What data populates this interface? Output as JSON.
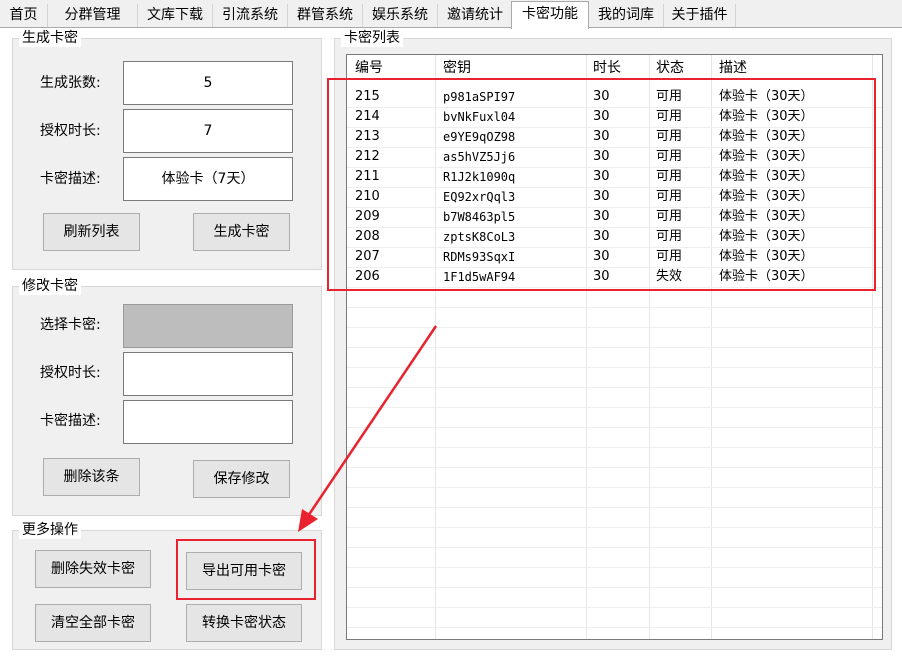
{
  "tabs": [
    "首页",
    "分群管理",
    "文库下载",
    "引流系统",
    "群管系统",
    "娱乐系统",
    "邀请统计",
    "卡密功能",
    "我的词库",
    "关于插件"
  ],
  "generate": {
    "title": "生成卡密",
    "count_label": "生成张数:",
    "count_value": "5",
    "duration_label": "授权时长:",
    "duration_value": "7",
    "desc_label": "卡密描述:",
    "desc_value": "体验卡（7天）",
    "refresh_button": "刷新列表",
    "generate_button": "生成卡密"
  },
  "modify": {
    "title": "修改卡密",
    "select_label": "选择卡密:",
    "duration_label": "授权时长:",
    "desc_label": "卡密描述:",
    "delete_button": "删除该条",
    "save_button": "保存修改"
  },
  "more": {
    "title": "更多操作",
    "delete_invalid_button": "删除失效卡密",
    "export_button": "导出可用卡密",
    "clear_all_button": "清空全部卡密",
    "convert_status_button": "转换卡密状态"
  },
  "list": {
    "title": "卡密列表",
    "headers": [
      "编号",
      "密钥",
      "时长",
      "状态",
      "描述"
    ],
    "rows": [
      [
        "215",
        "p981aSPI97",
        "30",
        "可用",
        "体验卡（30天）"
      ],
      [
        "214",
        "bvNkFuxl04",
        "30",
        "可用",
        "体验卡（30天）"
      ],
      [
        "213",
        "e9YE9qOZ98",
        "30",
        "可用",
        "体验卡（30天）"
      ],
      [
        "212",
        "as5hVZ5Jj6",
        "30",
        "可用",
        "体验卡（30天）"
      ],
      [
        "211",
        "R1J2k1090q",
        "30",
        "可用",
        "体验卡（30天）"
      ],
      [
        "210",
        "EQ92xrQql3",
        "30",
        "可用",
        "体验卡（30天）"
      ],
      [
        "209",
        "b7W8463pl5",
        "30",
        "可用",
        "体验卡（30天）"
      ],
      [
        "208",
        "zptsK8CoL3",
        "30",
        "可用",
        "体验卡（30天）"
      ],
      [
        "207",
        "RDMs93SqxI",
        "30",
        "可用",
        "体验卡（30天）"
      ],
      [
        "206",
        "1F1d5wAF94",
        "30",
        "失效",
        "体验卡（30天）"
      ]
    ]
  },
  "colors": {
    "annotation_red": "#e8232f"
  }
}
